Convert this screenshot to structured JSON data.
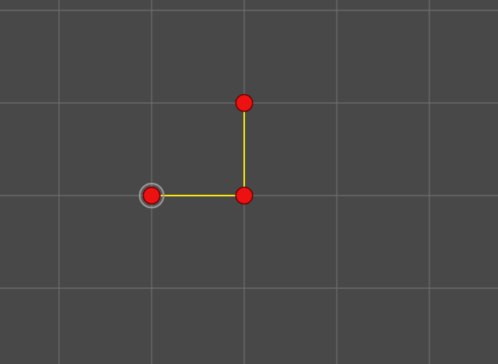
{
  "editor": {
    "background_color": "#484848",
    "grid_color": "#6e6e6e",
    "path_color": "#f5e60f",
    "point_fill": "#ee1111",
    "point_stroke": "#6a0000",
    "selection_halo_color": "#9a9a9a",
    "grid_spacing_units": 1,
    "points": [
      {
        "id": "point-1",
        "x": 1,
        "y": 2,
        "selected": true
      },
      {
        "id": "point-2",
        "x": 2,
        "y": 2,
        "selected": false
      },
      {
        "id": "point-3",
        "x": 2,
        "y": 1,
        "selected": false
      }
    ]
  }
}
